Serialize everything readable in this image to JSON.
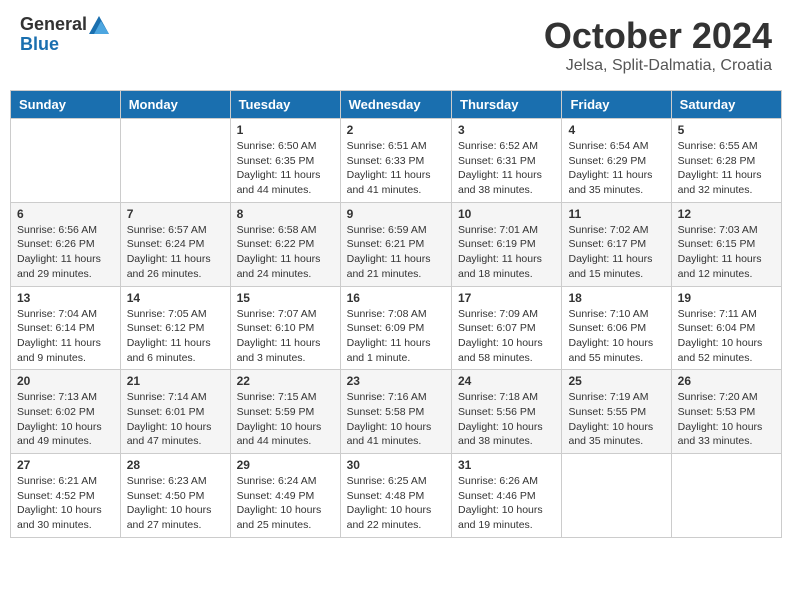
{
  "header": {
    "logo_general": "General",
    "logo_blue": "Blue",
    "month": "October 2024",
    "location": "Jelsa, Split-Dalmatia, Croatia"
  },
  "days_of_week": [
    "Sunday",
    "Monday",
    "Tuesday",
    "Wednesday",
    "Thursday",
    "Friday",
    "Saturday"
  ],
  "weeks": [
    [
      {
        "day": "",
        "info": ""
      },
      {
        "day": "",
        "info": ""
      },
      {
        "day": "1",
        "info": "Sunrise: 6:50 AM\nSunset: 6:35 PM\nDaylight: 11 hours and 44 minutes."
      },
      {
        "day": "2",
        "info": "Sunrise: 6:51 AM\nSunset: 6:33 PM\nDaylight: 11 hours and 41 minutes."
      },
      {
        "day": "3",
        "info": "Sunrise: 6:52 AM\nSunset: 6:31 PM\nDaylight: 11 hours and 38 minutes."
      },
      {
        "day": "4",
        "info": "Sunrise: 6:54 AM\nSunset: 6:29 PM\nDaylight: 11 hours and 35 minutes."
      },
      {
        "day": "5",
        "info": "Sunrise: 6:55 AM\nSunset: 6:28 PM\nDaylight: 11 hours and 32 minutes."
      }
    ],
    [
      {
        "day": "6",
        "info": "Sunrise: 6:56 AM\nSunset: 6:26 PM\nDaylight: 11 hours and 29 minutes."
      },
      {
        "day": "7",
        "info": "Sunrise: 6:57 AM\nSunset: 6:24 PM\nDaylight: 11 hours and 26 minutes."
      },
      {
        "day": "8",
        "info": "Sunrise: 6:58 AM\nSunset: 6:22 PM\nDaylight: 11 hours and 24 minutes."
      },
      {
        "day": "9",
        "info": "Sunrise: 6:59 AM\nSunset: 6:21 PM\nDaylight: 11 hours and 21 minutes."
      },
      {
        "day": "10",
        "info": "Sunrise: 7:01 AM\nSunset: 6:19 PM\nDaylight: 11 hours and 18 minutes."
      },
      {
        "day": "11",
        "info": "Sunrise: 7:02 AM\nSunset: 6:17 PM\nDaylight: 11 hours and 15 minutes."
      },
      {
        "day": "12",
        "info": "Sunrise: 7:03 AM\nSunset: 6:15 PM\nDaylight: 11 hours and 12 minutes."
      }
    ],
    [
      {
        "day": "13",
        "info": "Sunrise: 7:04 AM\nSunset: 6:14 PM\nDaylight: 11 hours and 9 minutes."
      },
      {
        "day": "14",
        "info": "Sunrise: 7:05 AM\nSunset: 6:12 PM\nDaylight: 11 hours and 6 minutes."
      },
      {
        "day": "15",
        "info": "Sunrise: 7:07 AM\nSunset: 6:10 PM\nDaylight: 11 hours and 3 minutes."
      },
      {
        "day": "16",
        "info": "Sunrise: 7:08 AM\nSunset: 6:09 PM\nDaylight: 11 hours and 1 minute."
      },
      {
        "day": "17",
        "info": "Sunrise: 7:09 AM\nSunset: 6:07 PM\nDaylight: 10 hours and 58 minutes."
      },
      {
        "day": "18",
        "info": "Sunrise: 7:10 AM\nSunset: 6:06 PM\nDaylight: 10 hours and 55 minutes."
      },
      {
        "day": "19",
        "info": "Sunrise: 7:11 AM\nSunset: 6:04 PM\nDaylight: 10 hours and 52 minutes."
      }
    ],
    [
      {
        "day": "20",
        "info": "Sunrise: 7:13 AM\nSunset: 6:02 PM\nDaylight: 10 hours and 49 minutes."
      },
      {
        "day": "21",
        "info": "Sunrise: 7:14 AM\nSunset: 6:01 PM\nDaylight: 10 hours and 47 minutes."
      },
      {
        "day": "22",
        "info": "Sunrise: 7:15 AM\nSunset: 5:59 PM\nDaylight: 10 hours and 44 minutes."
      },
      {
        "day": "23",
        "info": "Sunrise: 7:16 AM\nSunset: 5:58 PM\nDaylight: 10 hours and 41 minutes."
      },
      {
        "day": "24",
        "info": "Sunrise: 7:18 AM\nSunset: 5:56 PM\nDaylight: 10 hours and 38 minutes."
      },
      {
        "day": "25",
        "info": "Sunrise: 7:19 AM\nSunset: 5:55 PM\nDaylight: 10 hours and 35 minutes."
      },
      {
        "day": "26",
        "info": "Sunrise: 7:20 AM\nSunset: 5:53 PM\nDaylight: 10 hours and 33 minutes."
      }
    ],
    [
      {
        "day": "27",
        "info": "Sunrise: 6:21 AM\nSunset: 4:52 PM\nDaylight: 10 hours and 30 minutes."
      },
      {
        "day": "28",
        "info": "Sunrise: 6:23 AM\nSunset: 4:50 PM\nDaylight: 10 hours and 27 minutes."
      },
      {
        "day": "29",
        "info": "Sunrise: 6:24 AM\nSunset: 4:49 PM\nDaylight: 10 hours and 25 minutes."
      },
      {
        "day": "30",
        "info": "Sunrise: 6:25 AM\nSunset: 4:48 PM\nDaylight: 10 hours and 22 minutes."
      },
      {
        "day": "31",
        "info": "Sunrise: 6:26 AM\nSunset: 4:46 PM\nDaylight: 10 hours and 19 minutes."
      },
      {
        "day": "",
        "info": ""
      },
      {
        "day": "",
        "info": ""
      }
    ]
  ]
}
